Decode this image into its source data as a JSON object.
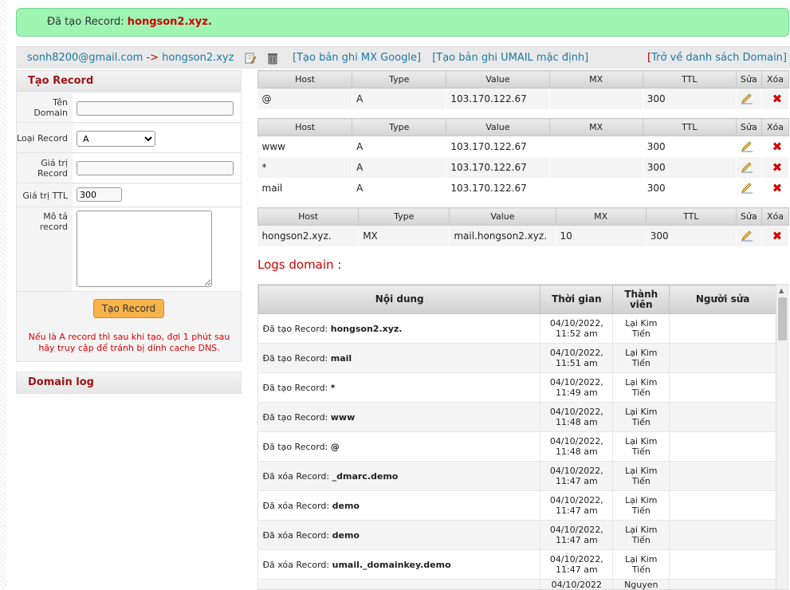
{
  "alert": {
    "prefix": "Đã tạo Record:",
    "value": "hongson2.xyz."
  },
  "bar": {
    "account": "sonh8200@gmail.com",
    "arrow": "->",
    "domain": "hongson2.xyz",
    "link1": "[Tạo bản ghi MX Google]",
    "link2": "[Tạo bản ghi UMAIL mặc định]",
    "back_bracket": "[",
    "back_text": "Trở về danh sách Domain]"
  },
  "form": {
    "title": "Tạo Record",
    "domain_label": "Tên Domain",
    "type_label": "Loại Record",
    "type_value": "A",
    "value_label": "Giá trị Record",
    "ttl_label": "Giá trị TTL",
    "ttl_value": "300",
    "desc_label": "Mô tả record",
    "submit": "Tạo Record",
    "note": "Nếu là A record thì sau khi tạo, đợi 1 phút sau hãy truy cập để tránh bị dính cache DNS."
  },
  "domain_log_title": "Domain log",
  "headers": {
    "host": "Host",
    "type": "Type",
    "value": "Value",
    "mx": "MX",
    "ttl": "TTL",
    "edit": "Sửa",
    "del": "Xóa"
  },
  "groups": [
    {
      "rows": [
        {
          "host": "@",
          "type": "A",
          "value": "103.170.122.67",
          "mx": "",
          "ttl": "300"
        }
      ]
    },
    {
      "rows": [
        {
          "host": "www",
          "type": "A",
          "value": "103.170.122.67",
          "mx": "",
          "ttl": "300"
        },
        {
          "host": "*",
          "type": "A",
          "value": "103.170.122.67",
          "mx": "",
          "ttl": "300"
        },
        {
          "host": "mail",
          "type": "A",
          "value": "103.170.122.67",
          "mx": "",
          "ttl": "300"
        }
      ]
    },
    {
      "rows": [
        {
          "host": "hongson2.xyz.",
          "type": "MX",
          "value": "mail.hongson2.xyz.",
          "mx": "10",
          "ttl": "300"
        }
      ]
    }
  ],
  "logs_title": "Logs domain :",
  "log_headers": {
    "content": "Nội dung",
    "time": "Thời gian",
    "member": "Thành viên",
    "editor": "Người sửa"
  },
  "logs": [
    {
      "action": "Đã tạo Record:",
      "target": "hongson2.xyz.",
      "date": "04/10/2022,",
      "time": "11:52 am",
      "member1": "Lại Kim",
      "member2": "Tiến"
    },
    {
      "action": "Đã tạo Record:",
      "target": "mail",
      "date": "04/10/2022,",
      "time": "11:51 am",
      "member1": "Lại Kim",
      "member2": "Tiến"
    },
    {
      "action": "Đã tạo Record:",
      "target": "*",
      "date": "04/10/2022,",
      "time": "11:49 am",
      "member1": "Lại Kim",
      "member2": "Tiến"
    },
    {
      "action": "Đã tạo Record:",
      "target": "www",
      "date": "04/10/2022,",
      "time": "11:48 am",
      "member1": "Lại Kim",
      "member2": "Tiến"
    },
    {
      "action": "Đã tạo Record:",
      "target": "@",
      "date": "04/10/2022,",
      "time": "11:48 am",
      "member1": "Lại Kim",
      "member2": "Tiến"
    },
    {
      "action": "Đã xóa Record:",
      "target": "_dmarc.demo",
      "date": "04/10/2022,",
      "time": "11:47 am",
      "member1": "Lại Kim",
      "member2": "Tiến"
    },
    {
      "action": "Đã xóa Record:",
      "target": "demo",
      "date": "04/10/2022,",
      "time": "11:47 am",
      "member1": "Lại Kim",
      "member2": "Tiến"
    },
    {
      "action": "Đã xóa Record:",
      "target": "demo",
      "date": "04/10/2022,",
      "time": "11:47 am",
      "member1": "Lại Kim",
      "member2": "Tiến"
    },
    {
      "action": "Đã xóa Record:",
      "target": "umail._domainkey.demo",
      "date": "04/10/2022,",
      "time": "11:47 am",
      "member1": "Lại Kim",
      "member2": "Tiến"
    },
    {
      "action": "",
      "target": "",
      "date": "04/10/2022",
      "time": "",
      "member1": "Nguyen",
      "member2": ""
    }
  ]
}
